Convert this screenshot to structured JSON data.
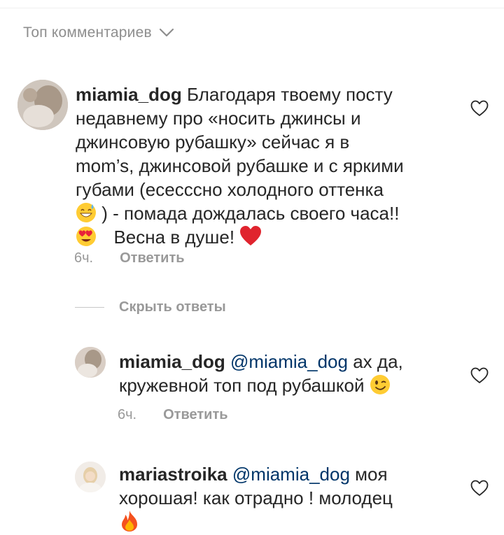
{
  "header": {
    "sort_label": "Топ комментариев",
    "sort_icon": "chevron-down-icon"
  },
  "comments": [
    {
      "username": "miamia_dog",
      "lines": [
        "Благодаря твоему посту",
        "недавнему про «носить джинсы и",
        "джинсовую рубашку» сейчас я в",
        "mom’s, джинсовой рубашке и с яркими",
        "губами (есесссно холодного оттенка"
      ],
      "line6": ") - помада дождалась своего часа!!",
      "line7": "Весна в душе!",
      "emojis": [
        "grinning-sweat-emoji",
        "heart-eyes-emoji",
        "red-heart-emoji"
      ],
      "time": "6ч.",
      "reply_label": "Ответить"
    }
  ],
  "hide_replies_label": "Скрыть ответы",
  "replies": [
    {
      "username": "miamia_dog",
      "mention": "@miamia_dog",
      "text_line1": " ах да,",
      "text_line2": "кружевной топ под рубашкой",
      "emoji": "winking-face-emoji",
      "time": "6ч.",
      "reply_label": "Ответить"
    },
    {
      "username": "mariastroika",
      "mention": "@miamia_dog",
      "text_line1": " моя",
      "text_line2": "хорошая! как отрадно ! молодец",
      "emoji": "fire-emoji"
    }
  ],
  "colors": {
    "mention": "#003569",
    "meta": "#999999",
    "text": "#262626"
  }
}
